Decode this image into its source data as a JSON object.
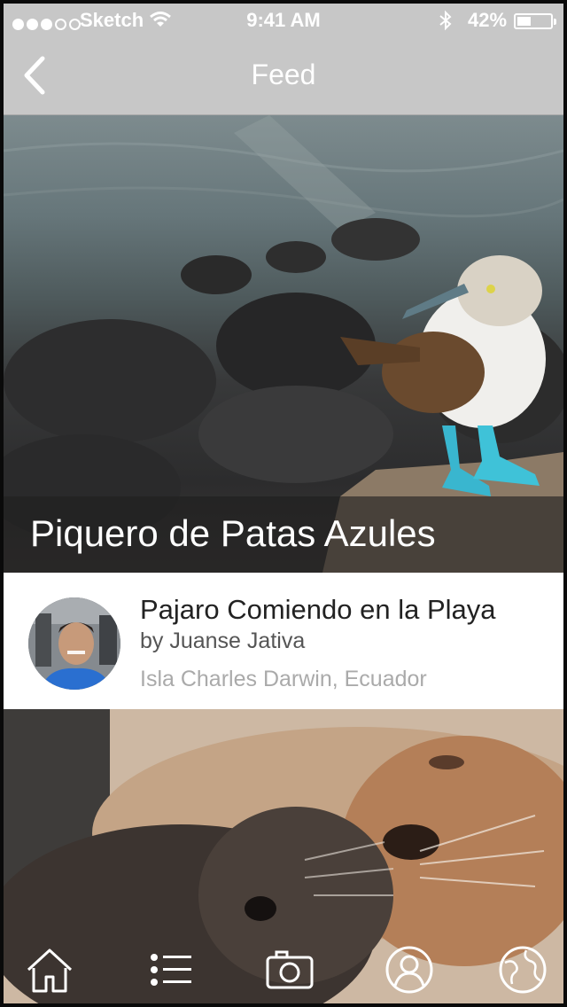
{
  "status_bar": {
    "signal_bars_filled": 3,
    "signal_bars_total": 5,
    "carrier": "Sketch",
    "wifi_icon": "wifi-icon",
    "time": "9:41 AM",
    "bluetooth_icon": "bluetooth-icon",
    "battery_percent": "42%",
    "battery_level": 0.42
  },
  "nav": {
    "back_icon": "chevron-left-icon",
    "title": "Feed"
  },
  "hero": {
    "title": "Piquero de Patas Azules"
  },
  "post": {
    "title": "Pajaro Comiendo en la Playa",
    "author": "by Juanse Jativa",
    "location": "Isla Charles Darwin, Ecuador"
  },
  "tab_bar": {
    "items": [
      {
        "icon": "home-icon"
      },
      {
        "icon": "list-icon"
      },
      {
        "icon": "camera-icon"
      },
      {
        "icon": "profile-icon"
      },
      {
        "icon": "globe-icon"
      }
    ]
  },
  "colors": {
    "nav_background": "#c7c7c7",
    "caption_overlay": "#1e1e1e",
    "post_title": "#222222",
    "post_location": "#aaaaaa"
  }
}
